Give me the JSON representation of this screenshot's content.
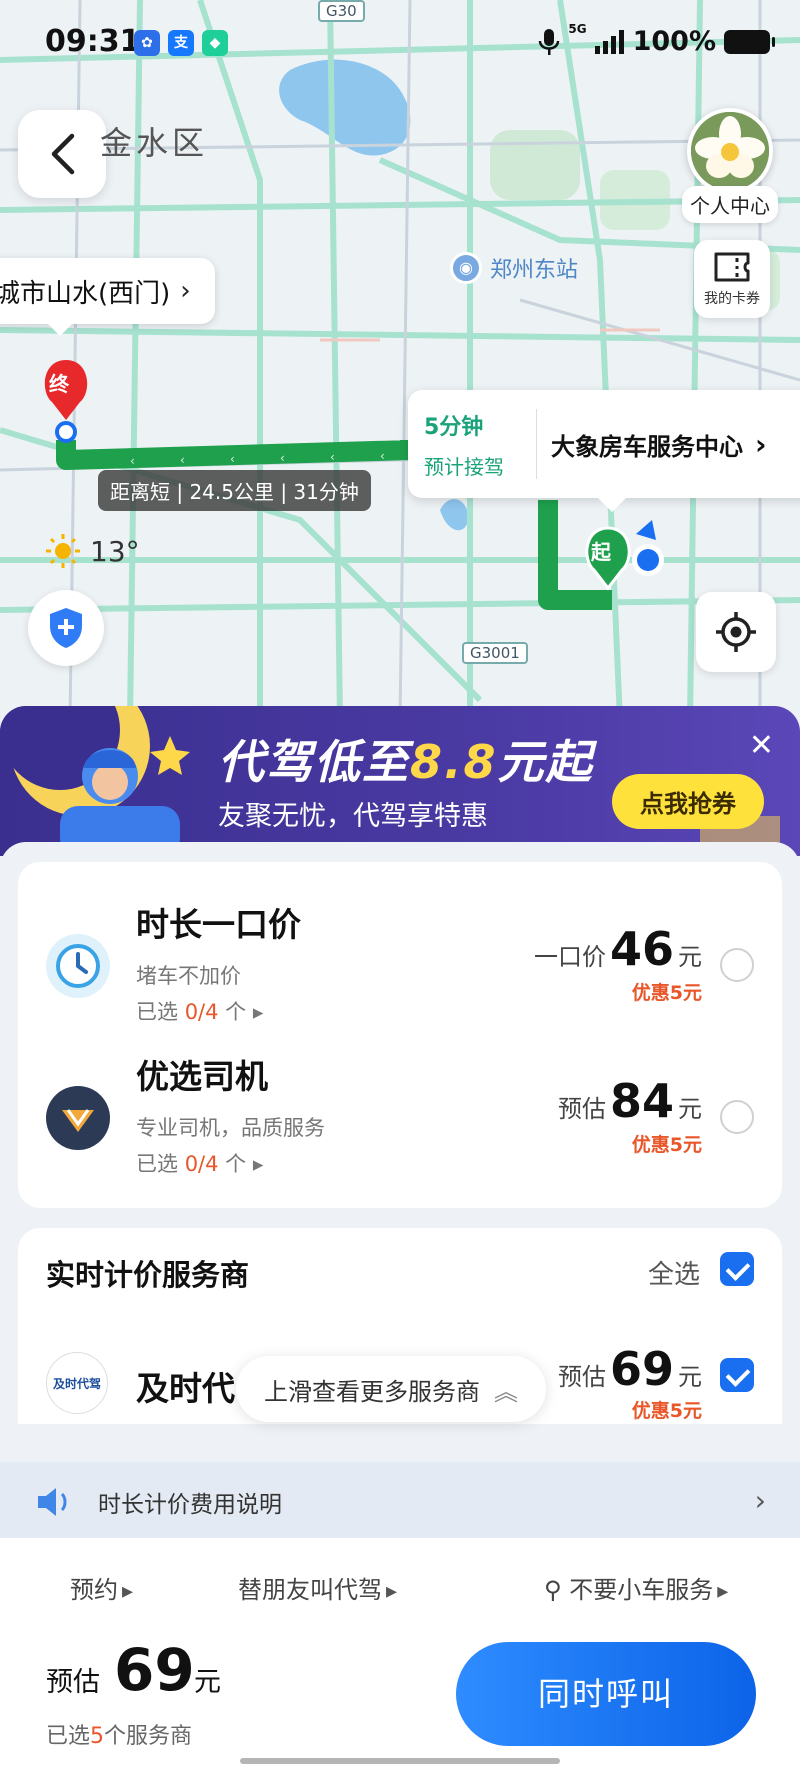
{
  "status_bar": {
    "time": "09:31",
    "network": "5G",
    "battery": "100%"
  },
  "map": {
    "district": "金水区",
    "destination": "城市山水(西门)",
    "station": "郑州东站",
    "route_info": "距离短 | 24.5公里 | 31分钟",
    "pickup_time": "5分钟",
    "pickup_label": "预计接驾",
    "pickup_place": "大象房车服务中心",
    "end_marker": "终",
    "start_marker": "起",
    "weather_temp": "13°",
    "highway_top": "G30",
    "highway_bottom": "G3001",
    "profile_label": "个人中心",
    "cards_label": "我的卡券",
    "colors": {
      "route": "#1ea04c",
      "road": "#a7e2cf"
    }
  },
  "promo": {
    "title_pre": "代驾低至",
    "title_hl": "8.8",
    "title_post": "元起",
    "subtitle": "友聚无忧，代驾享特惠",
    "cta": "点我抢券"
  },
  "services": [
    {
      "name": "时长一口价",
      "desc": "堵车不加价",
      "sel_prefix": "已选 ",
      "sel_num": "0/4",
      "sel_suffix": " 个",
      "price_label": "一口价",
      "price": "46",
      "unit": "元",
      "discount": "优惠5元"
    },
    {
      "name": "优选司机",
      "desc": "专业司机，品质服务",
      "sel_prefix": "已选 ",
      "sel_num": "0/4",
      "sel_suffix": " 个",
      "price_label": "预估",
      "price": "84",
      "unit": "元",
      "discount": "优惠5元"
    }
  ],
  "realtime": {
    "title": "实时计价服务商",
    "select_all": "全选",
    "provider_logo": "及时代驾",
    "provider_name": "及时代",
    "price_label": "预估",
    "price": "69",
    "unit": "元",
    "discount": "优惠5元",
    "swipe_hint": "上滑查看更多服务商"
  },
  "fee_note": "时长计价费用说明",
  "bottom": {
    "opt1": "预约",
    "opt2": "替朋友叫代驾",
    "opt3": "不要小车服务",
    "est_label": "预估",
    "est_price": "69",
    "est_unit": "元",
    "sel_prefix": "已选",
    "sel_num": "5",
    "sel_suffix": "个服务商",
    "call": "同时呼叫"
  }
}
